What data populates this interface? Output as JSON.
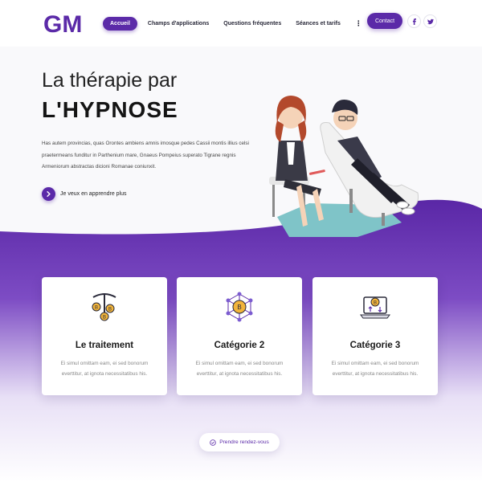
{
  "header": {
    "logo_text": "GM",
    "nav": [
      {
        "label": "Accueil",
        "active": true
      },
      {
        "label": "Champs d'applications",
        "active": false
      },
      {
        "label": "Questions fréquentes",
        "active": false
      },
      {
        "label": "Séances et tarifs",
        "active": false
      }
    ],
    "more_label": "⋮",
    "contact_label": "Contact",
    "social": [
      "facebook-icon",
      "twitter-icon"
    ]
  },
  "hero": {
    "title_line1": "La thérapie par",
    "title_line2": "L'HYPNOSE",
    "paragraph": "Has autem provincias, quas Orontes ambiens amnis imosque pedes Cassii montis illius celsi praetermeans funditur in Parthenium mare, Gnaeus Pompeius superato Tigrane regnis Armeniorum abstractas dicioni Romanae coniunxit.",
    "cta_label": "Je veux en apprendre plus"
  },
  "cards": [
    {
      "title": "Le traitement",
      "text": "Ei simul omittam eam, ei sed bonorum everttitur, at ignota necessitatibus his.",
      "icon": "pickaxe-coins-icon"
    },
    {
      "title": "Catégorie 2",
      "text": "Ei simul omittam eam, ei sed bonorum everttitur, at ignota necessitatibus his.",
      "icon": "network-coin-icon"
    },
    {
      "title": "Catégorie 3",
      "text": "Ei simul omittam eam, ei sed bonorum everttitur, at ignota necessitatibus his.",
      "icon": "laptop-transfer-icon"
    }
  ],
  "appointment_label": "Prendre rendez-vous",
  "colors": {
    "accent": "#5b2aa8",
    "wave_top": "#5b2aa8",
    "wave_bottom": "#ffffff"
  }
}
